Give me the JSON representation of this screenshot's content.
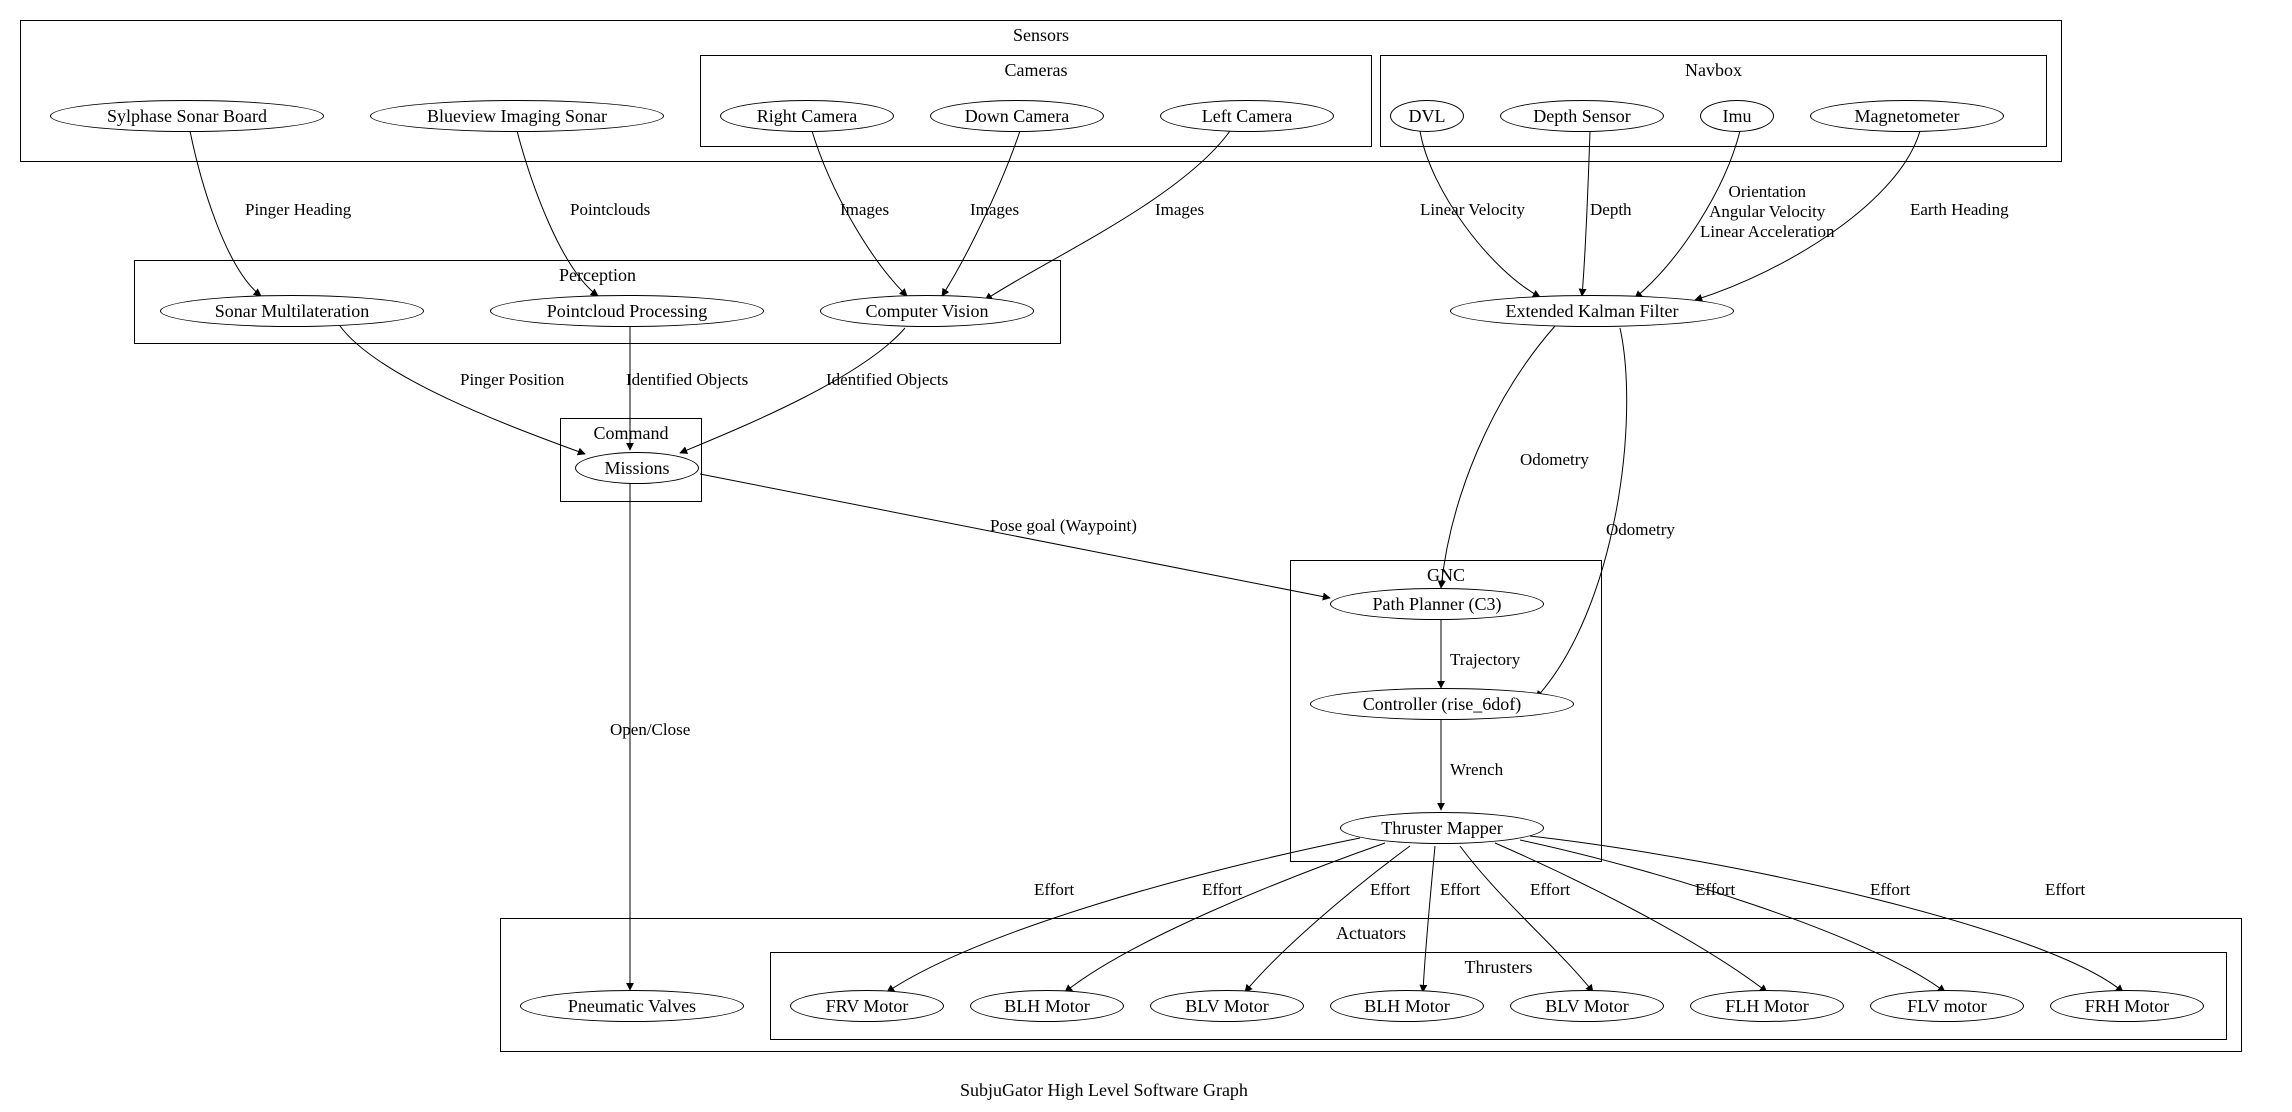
{
  "caption": "SubjuGator High Level Software Graph",
  "clusters": {
    "sensors": "Sensors",
    "cameras": "Cameras",
    "navbox": "Navbox",
    "perception": "Perception",
    "command": "Command",
    "gnc": "GNC",
    "actuators": "Actuators",
    "thrusters": "Thrusters"
  },
  "nodes": {
    "sylphase": "Sylphase Sonar Board",
    "blueview": "Blueview Imaging Sonar",
    "rcam": "Right Camera",
    "dcam": "Down Camera",
    "lcam": "Left Camera",
    "dvl": "DVL",
    "depth": "Depth Sensor",
    "imu": "Imu",
    "mag": "Magnetometer",
    "sonarml": "Sonar Multilateration",
    "pcproc": "Pointcloud Processing",
    "cv": "Computer Vision",
    "ekf": "Extended Kalman Filter",
    "missions": "Missions",
    "pp": "Path Planner (C3)",
    "ctrl": "Controller (rise_6dof)",
    "tmap": "Thruster Mapper",
    "pvalves": "Pneumatic Valves",
    "th0": "FRV Motor",
    "th1": "BLH Motor",
    "th2": "BLV Motor",
    "th3": "BLH Motor",
    "th4": "BLV Motor",
    "th5": "FLH Motor",
    "th6": "FLV motor",
    "th7": "FRH Motor"
  },
  "edges": {
    "pinger_heading": "Pinger Heading",
    "pointclouds": "Pointclouds",
    "images1": "Images",
    "images2": "Images",
    "images3": "Images",
    "linvel": "Linear Velocity",
    "depthm": "Depth",
    "imu_m": "Orientation\nAngular Velocity\nLinear Acceleration",
    "earth_h": "Earth Heading",
    "pinger_pos": "Pinger Position",
    "ident1": "Identified Objects",
    "ident2": "Identified Objects",
    "odom1": "Odometry",
    "odom2": "Odometry",
    "posegoal": "Pose goal (Waypoint)",
    "traj": "Trajectory",
    "wrench": "Wrench",
    "openclose": "Open/Close",
    "eff0": "Effort",
    "eff1": "Effort",
    "eff2": "Effort",
    "eff3": "Effort",
    "eff4": "Effort",
    "eff5": "Effort",
    "eff6": "Effort",
    "eff7": "Effort"
  }
}
